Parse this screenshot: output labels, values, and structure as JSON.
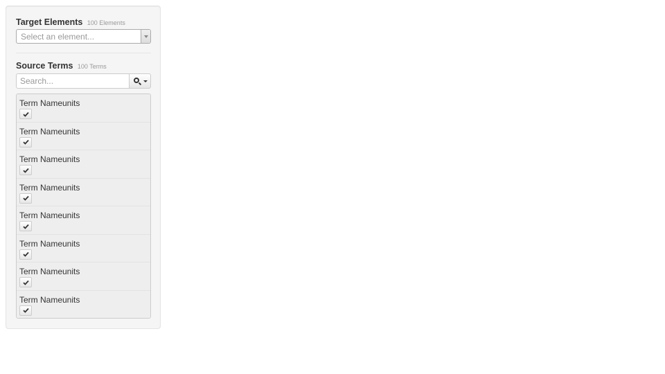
{
  "target_elements": {
    "title": "Target Elements",
    "count": "100 Elements",
    "select_placeholder": "Select an element..."
  },
  "source_terms": {
    "title": "Source Terms",
    "count": "100 Terms",
    "search_placeholder": "Search...",
    "search_icon": "search-icon",
    "items": [
      {
        "name": "Term Nameunits",
        "checked": true
      },
      {
        "name": "Term Nameunits",
        "checked": true
      },
      {
        "name": "Term Nameunits",
        "checked": true
      },
      {
        "name": "Term Nameunits",
        "checked": true
      },
      {
        "name": "Term Nameunits",
        "checked": true
      },
      {
        "name": "Term Nameunits",
        "checked": true
      },
      {
        "name": "Term Nameunits",
        "checked": true
      },
      {
        "name": "Term Nameunits",
        "checked": true
      }
    ]
  },
  "colors": {
    "panel_bg": "#f5f5f5",
    "list_bg": "#eeeeee",
    "text": "#333333",
    "muted": "#999999"
  }
}
